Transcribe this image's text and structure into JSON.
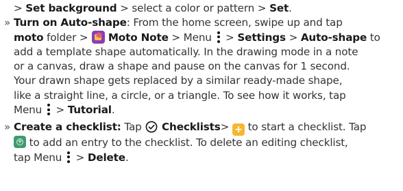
{
  "intro": {
    "prefix": "> ",
    "set_background": "Set background",
    "mid": " > select a color or pattern > ",
    "set": "Set",
    "end": "."
  },
  "autoshape": {
    "bullet": "»",
    "title": "Turn on Auto-shape",
    "lines": {
      "l1_after_title": ": From the home screen, swipe up and tap",
      "moto": "moto",
      "folder": " folder > ",
      "moto_note": "Moto Note",
      "menu_text": " > Menu ",
      "gt1": " > ",
      "settings": "Settings",
      "gt2": " > ",
      "auto_shape": "Auto-shape",
      "to": " to",
      "l3": "add a template shape automatically. In the drawing mode in a note",
      "l4": "or a canvas, draw a shape and pause on the canvas for 1 second.",
      "l5": "Your drawn shape gets replaced by a similar ready-made shape,",
      "l6": "like a straight line, a circle, or a triangle. To see how it works, tap",
      "l7_menu": "Menu ",
      "l7_gt": " > ",
      "tutorial": "Tutorial",
      "l7_end": "."
    }
  },
  "checklist": {
    "bullet": "»",
    "title": "Create a checklist:",
    "tap": " Tap ",
    "checklists": "Checklists",
    "gt": "> ",
    "start": " to start a checklist. Tap",
    "l2_end": " to add an entry to the checklist. To delete an editing checklist,",
    "l3_tap": "tap Menu ",
    "l3_gt": " > ",
    "delete": "Delete",
    "l3_end": "."
  },
  "icons": {
    "app": "moto-note-app-icon",
    "menu": "three-dot-menu-icon",
    "check": "checklist-circle-check-icon",
    "plus": "add-plus-icon",
    "add_entry": "add-entry-icon"
  },
  "colors": {
    "text": "#333333",
    "bold": "#1a1a1a",
    "app_icon": "#8a3fb5",
    "plus_icon": "#f5b731",
    "add_entry_icon": "#3f9b6e"
  }
}
